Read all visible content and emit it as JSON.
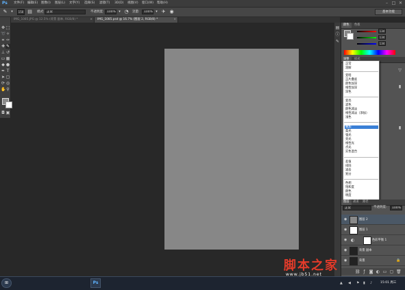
{
  "app": {
    "logo": "Ps"
  },
  "menubar": {
    "items": [
      "文件(F)",
      "编辑(E)",
      "图像(I)",
      "图层(L)",
      "文字(Y)",
      "选择(S)",
      "滤镜(T)",
      "3D(D)",
      "视图(V)",
      "窗口(W)",
      "帮助(H)"
    ],
    "minimize": "–",
    "maximize": "□",
    "close": "✕"
  },
  "options": {
    "brush_size": "150",
    "mode_label": "模式:",
    "mode_value": "正常",
    "opacity_label": "不透明度:",
    "opacity_value": "100%",
    "flow_label": "流量:",
    "flow_value": "100%",
    "workspace": "基本功能"
  },
  "tabs": [
    {
      "label": "IMG_1085.JPG @ 12.5% (背景 副本, RGB/8) *",
      "close": "×"
    },
    {
      "label": "IMG_1085.psd @ 16.7% (图层 2, RGB/8) *",
      "close": "×"
    }
  ],
  "color_panel": {
    "tabs": [
      "颜色",
      "色板"
    ],
    "r": "134",
    "g": "134",
    "b": "134"
  },
  "adjust_panel": {
    "tabs": [
      "调整",
      "样式"
    ]
  },
  "blend_modes": {
    "groups": [
      [
        "正常",
        "溶解"
      ],
      [
        "变暗",
        "正片叠底",
        "颜色加深",
        "线性加深",
        "深色"
      ],
      [
        "变亮",
        "滤色",
        "颜色减淡",
        "线性减淡（添加）",
        "浅色"
      ],
      [
        "叠加",
        "柔光",
        "强光",
        "亮光",
        "线性光",
        "点光",
        "实色混合"
      ],
      [
        "差值",
        "排除",
        "减去",
        "划分"
      ],
      [
        "色相",
        "饱和度",
        "颜色",
        "明度"
      ]
    ],
    "selected": "叠加"
  },
  "layers_panel": {
    "tabs": [
      "图层",
      "通道",
      "路径"
    ],
    "blend_value": "正常",
    "opacity_label": "不透明度:",
    "opacity_value": "100%",
    "layers": [
      {
        "name": "图层 2",
        "selected": true,
        "thumb": "#8a8a8a"
      },
      {
        "name": "图层 1",
        "selected": false,
        "thumb": "#ffffff"
      },
      {
        "name": "色彩平衡 1",
        "selected": false,
        "thumb": "#ffffff"
      },
      {
        "name": "背景 副本",
        "selected": false,
        "thumb": "#222222"
      },
      {
        "name": "背景",
        "selected": false,
        "thumb": "#222222"
      }
    ]
  },
  "taskbar": {
    "clock": "15:01 周三"
  },
  "watermark": {
    "brand": "脚本之家",
    "url": "www.jb51.net"
  }
}
